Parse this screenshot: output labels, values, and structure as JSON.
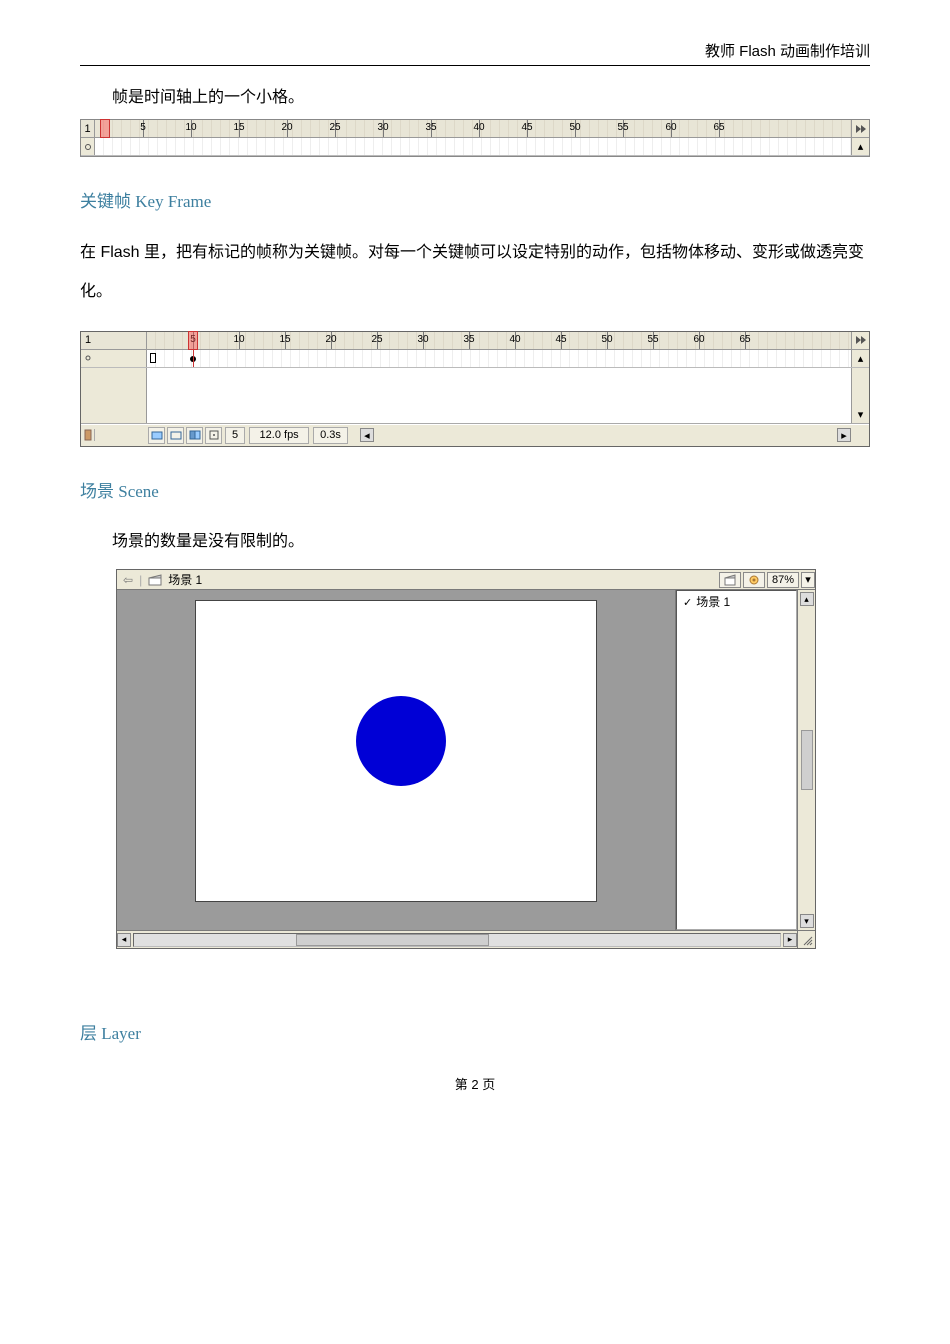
{
  "header": {
    "title": "教师 Flash 动画制作培训"
  },
  "intro": {
    "text": "帧是时间轴上的一个小格。"
  },
  "timeline1": {
    "start_label": "1",
    "ticks": [
      5,
      10,
      15,
      20,
      25,
      30,
      35,
      40,
      45,
      50,
      55,
      60,
      65
    ],
    "playhead_frame": 1
  },
  "section_keyframe": {
    "heading": "关键帧  Key Frame",
    "para": "在 Flash 里，把有标记的帧称为关键帧。对每一个关键帧可以设定特别的动作，包括物体移动、变形或做透亮变化。"
  },
  "timeline2": {
    "start_label": "1",
    "ticks": [
      5,
      10,
      15,
      20,
      25,
      30,
      35,
      40,
      45,
      50,
      55,
      60,
      65
    ],
    "playhead_frame": 5,
    "status": {
      "frame": "5",
      "fps": "12.0 fps",
      "elapsed": "0.3s"
    }
  },
  "section_scene": {
    "heading": "场景  Scene",
    "para": "场景的数量是没有限制的。"
  },
  "scene_panel": {
    "breadcrumb": {
      "back": "⇦",
      "scene_label": "场景 1"
    },
    "zoom": "87%",
    "scene_list": {
      "selected": "场景 1"
    }
  },
  "section_layer": {
    "heading": "层  Layer"
  },
  "footer": {
    "page_label": "第 2 页"
  }
}
